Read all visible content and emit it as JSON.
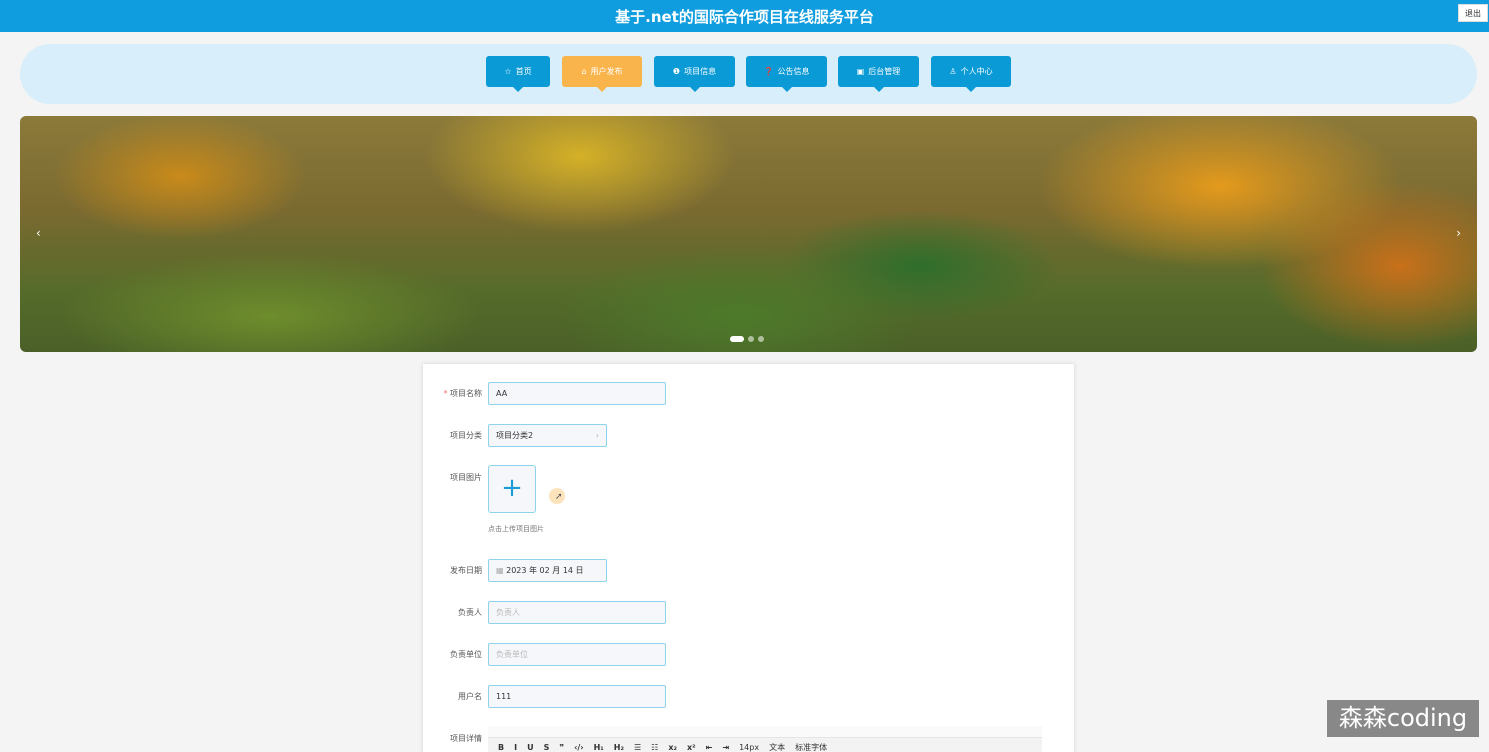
{
  "header": {
    "title": "基于.net的国际合作项目在线服务平台",
    "logout": "退出"
  },
  "nav": [
    {
      "icon": "☆",
      "label": "首页"
    },
    {
      "icon": "⌂",
      "label": "用户发布"
    },
    {
      "icon": "❶",
      "label": "项目信息"
    },
    {
      "icon": "❓",
      "label": "公告信息"
    },
    {
      "icon": "▣",
      "label": "后台管理"
    },
    {
      "icon": "♙",
      "label": "个人中心"
    }
  ],
  "banner": {
    "prev": "‹",
    "next": "›"
  },
  "form": {
    "name_label": "项目名称",
    "name_value": "AA",
    "category_label": "项目分类",
    "category_value": "项目分类2",
    "image_label": "项目图片",
    "upload_plus": "+",
    "upload_hint": "点击上传项目图片",
    "date_label": "发布日期",
    "date_value": "2023 年 02 月 14 日",
    "owner_label": "负责人",
    "owner_placeholder": "负责人",
    "unit_label": "负责单位",
    "unit_placeholder": "负责单位",
    "user_label": "用户名",
    "user_value": "111",
    "detail_label": "项目详情"
  },
  "toolbar": {
    "items": [
      "B",
      "I",
      "U",
      "S",
      "❞",
      "‹/›",
      "H₁",
      "H₂",
      "☰",
      "☷",
      "x₂",
      "x²",
      "⇤",
      "⇥"
    ],
    "font_size": "14px",
    "text_type": "文本",
    "font_family": "标准字体"
  },
  "watermark": "森森coding"
}
